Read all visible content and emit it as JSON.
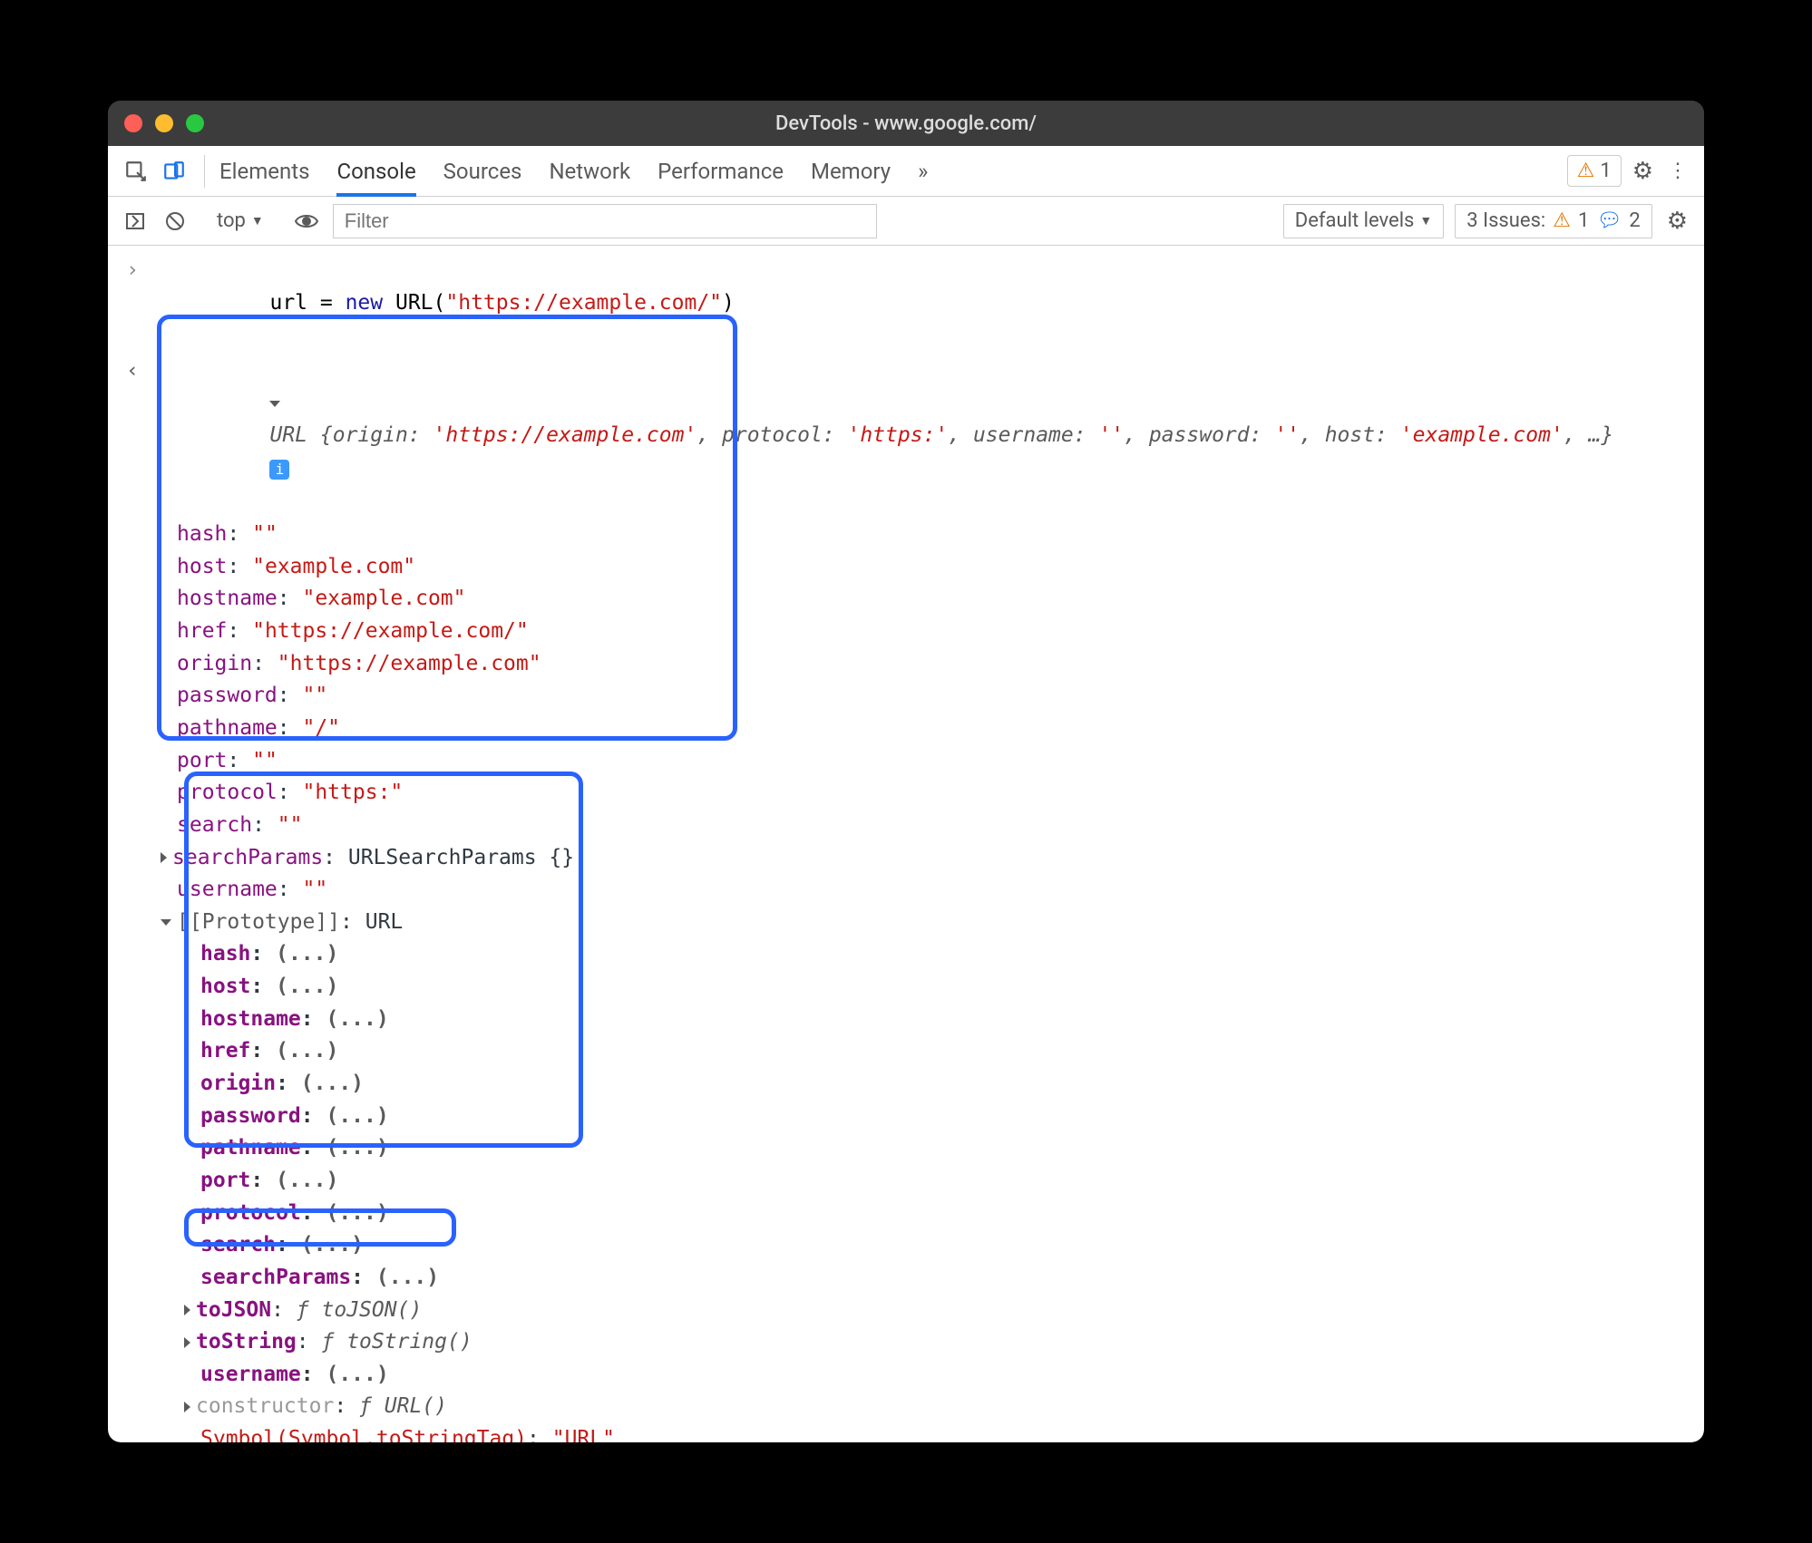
{
  "window": {
    "title": "DevTools - www.google.com/"
  },
  "toolbar": {
    "tabs": [
      "Elements",
      "Console",
      "Sources",
      "Network",
      "Performance",
      "Memory"
    ],
    "active_tab": "Console",
    "warn_count": "1"
  },
  "subtoolbar": {
    "context": "top",
    "filter_placeholder": "Filter",
    "levels": "Default levels",
    "issues_label": "3 Issues:",
    "issues_warn": "1",
    "issues_msg": "2"
  },
  "input_line": {
    "lhs": "url = ",
    "kw_new": "new",
    "ctor": " URL(",
    "arg": "\"https://example.com/\"",
    "close": ")"
  },
  "summary": {
    "pre": "URL {",
    "origin_k": "origin: ",
    "origin_v": "'https://example.com'",
    "protocol_k": ", protocol: ",
    "protocol_v": "'https:'",
    "username_k": ", username: ",
    "username_v": "''",
    "password_k": ", password: ",
    "password_v": "''",
    "host_k": ", host: ",
    "host_v": "'example.com'",
    "ellipsis": ", …}"
  },
  "props": [
    {
      "k": "hash",
      "v": "\"\""
    },
    {
      "k": "host",
      "v": "\"example.com\""
    },
    {
      "k": "hostname",
      "v": "\"example.com\""
    },
    {
      "k": "href",
      "v": "\"https://example.com/\""
    },
    {
      "k": "origin",
      "v": "\"https://example.com\""
    },
    {
      "k": "password",
      "v": "\"\""
    },
    {
      "k": "pathname",
      "v": "\"/\""
    },
    {
      "k": "port",
      "v": "\"\""
    },
    {
      "k": "protocol",
      "v": "\"https:\""
    },
    {
      "k": "search",
      "v": "\"\""
    }
  ],
  "searchParams": {
    "k": "searchParams",
    "v": "URLSearchParams {}"
  },
  "username2": {
    "k": "username",
    "v": "\"\""
  },
  "proto_label": "[[Prototype]]",
  "proto_type": "URL",
  "proto_props": [
    "hash",
    "host",
    "hostname",
    "href",
    "origin",
    "password",
    "pathname",
    "port",
    "protocol",
    "search",
    "searchParams"
  ],
  "proto_deferred": "(...)",
  "proto_tail": {
    "toJSON_k": "toJSON",
    "toJSON_v": "toJSON()",
    "toString_k": "toString",
    "toString_v": "toString()",
    "username_k": "username",
    "ctor_k": "constructor",
    "ctor_v": "URL()",
    "sym": "Symbol(Symbol.toStringTag)",
    "sym_v": "\"URL\""
  },
  "f_italic": "ƒ"
}
